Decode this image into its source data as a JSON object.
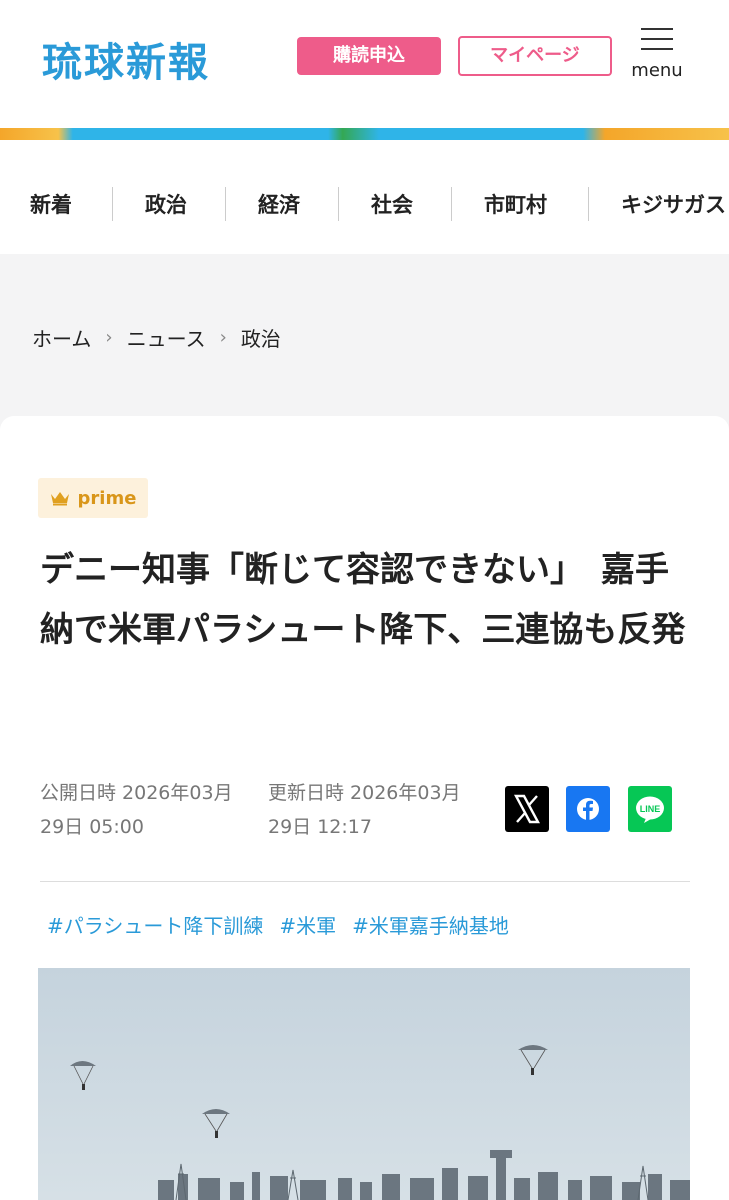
{
  "header": {
    "logo": "琉球新報",
    "subscribe_label": "購読申込",
    "mypage_label": "マイページ",
    "menu_label": "menu"
  },
  "nav": {
    "items": [
      {
        "label": "新着"
      },
      {
        "label": "政治"
      },
      {
        "label": "経済"
      },
      {
        "label": "社会"
      },
      {
        "label": "市町村"
      },
      {
        "label": "キジサガス"
      }
    ]
  },
  "breadcrumb": {
    "items": [
      "ホーム",
      "ニュース",
      "政治"
    ]
  },
  "article": {
    "badge": "prime",
    "title": "デニー知事「断じて容認できない」　嘉手納で米軍パラシュート降下、三連協も反発",
    "published_label": "公開日時 2026年03月29日 05:00",
    "updated_label": "更新日時 2026年03月29日 12:17",
    "tags": [
      "#パラシュート降下訓練",
      "#米軍",
      "#米軍嘉手納基地"
    ]
  },
  "share": {
    "line_label": "LINE"
  },
  "colors": {
    "brand_blue": "#2a9ad8",
    "accent_pink": "#ee5c8a",
    "prime_gold": "#d9961a",
    "facebook": "#1877f2",
    "line": "#06c755"
  }
}
